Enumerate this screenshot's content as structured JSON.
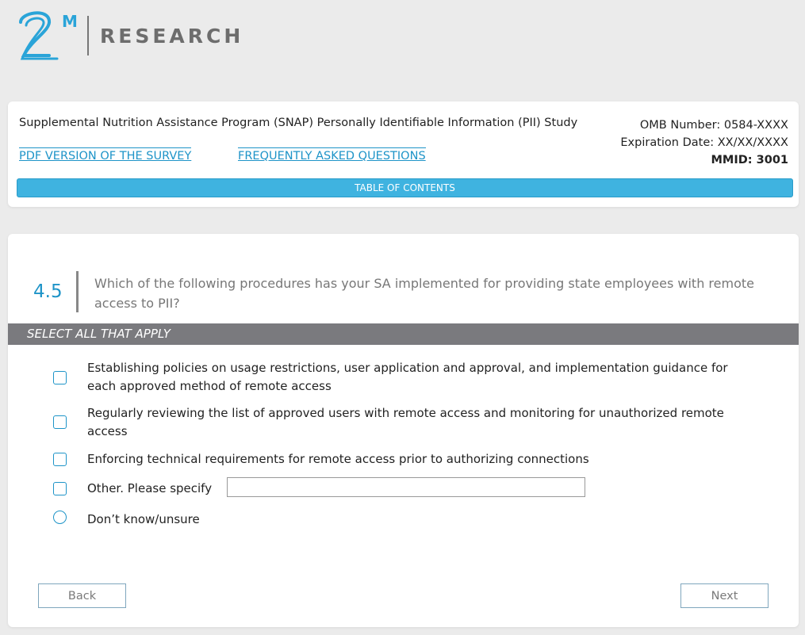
{
  "logo": {
    "superscript": "M",
    "name": "RESEARCH"
  },
  "header": {
    "study_title": "Supplemental Nutrition Assistance Program (SNAP) Personally Identifiable Information (PII) Study",
    "omb_number": "OMB Number: 0584-XXXX",
    "expiration": "Expiration Date: XX/XX/XXXX",
    "mmid": "MMID: 3001",
    "pdf_link": "PDF VERSION OF THE SURVEY",
    "faq_link": "FREQUENTLY ASKED QUESTIONS",
    "toc_label": "TABLE OF CONTENTS"
  },
  "question": {
    "number": "4.5",
    "text": "Which of the following procedures has your SA implemented for providing state employees with remote access to PII?",
    "instruction": "SELECT ALL THAT APPLY",
    "options": [
      {
        "label": "Establishing policies on usage restrictions, user application and approval, and implementation guidance for each approved method of remote access",
        "type": "checkbox"
      },
      {
        "label": "Regularly reviewing the list of approved users with remote access and monitoring for unauthorized remote access",
        "type": "checkbox"
      },
      {
        "label": "Enforcing technical requirements for remote access prior to authorizing connections",
        "type": "checkbox"
      },
      {
        "label": "Other. Please specify",
        "type": "checkbox"
      },
      {
        "label": "Don’t know/unsure",
        "type": "radio"
      }
    ],
    "other_value": ""
  },
  "nav": {
    "back_label": "Back",
    "next_label": "Next"
  },
  "colors": {
    "accent": "#1e94c8",
    "toc_bar": "#3fb3e0",
    "instruction_bar": "#7a7a7e",
    "background": "#ebebeb"
  }
}
